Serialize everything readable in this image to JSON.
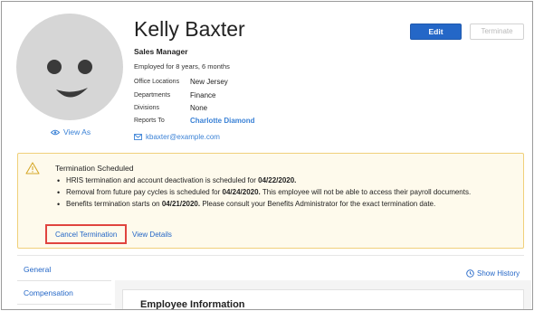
{
  "employee": {
    "name": "Kelly Baxter",
    "title": "Sales Manager",
    "tenure": "Employed for 8 years, 6 months",
    "email": "kbaxter@example.com",
    "view_as": "View As",
    "details": [
      {
        "label": "Office Locations",
        "value": "New Jersey"
      },
      {
        "label": "Departments",
        "value": "Finance"
      },
      {
        "label": "Divisions",
        "value": "None"
      },
      {
        "label": "Reports To",
        "value": "Charlotte Diamond"
      }
    ]
  },
  "actions": {
    "edit": "Edit",
    "terminate": "Terminate"
  },
  "alert": {
    "heading": "Termination Scheduled",
    "items": [
      {
        "text": "HRIS termination and account deactivation is scheduled for ",
        "bold": "04/22/2020.",
        "after": ""
      },
      {
        "text": "Removal from future pay cycles is scheduled for ",
        "bold": "04/24/2020.",
        "after": " This employee will not be able to access their payroll documents."
      },
      {
        "text": "Benefits termination starts on ",
        "bold": "04/21/2020.",
        "after": " Please consult your Benefits Administrator for the exact termination date."
      }
    ],
    "cancel_label": "Cancel Termination",
    "details_label": "View Details",
    "accent_color": "#f0d07a",
    "highlight_color": "#e0443f"
  },
  "nav": {
    "items": [
      "General",
      "Compensation"
    ],
    "show_history": "Show History"
  },
  "panel": {
    "title": "Employee Information"
  },
  "colors": {
    "brand": "#2467c7",
    "link": "#3b82d6"
  },
  "icons": {
    "avatar": "person-placeholder-icon",
    "view_as": "eye-icon",
    "email": "envelope-icon",
    "alert": "warning-triangle-icon",
    "history": "clock-icon"
  }
}
